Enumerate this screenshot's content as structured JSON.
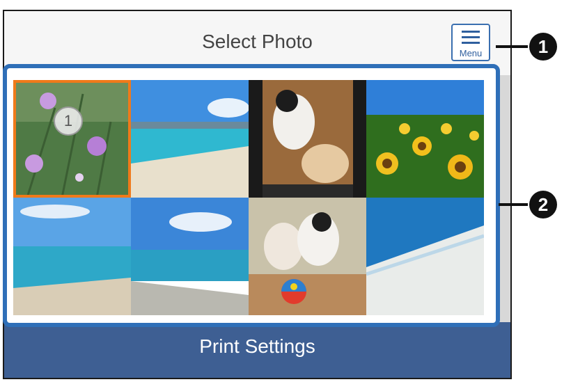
{
  "header": {
    "title": "Select Photo"
  },
  "menu_button": {
    "label": "Menu",
    "icon": "menu-icon"
  },
  "photos": [
    {
      "subject": "flowers",
      "selected": true,
      "selection_number": "1"
    },
    {
      "subject": "beach"
    },
    {
      "subject": "dogs"
    },
    {
      "subject": "sunflowers"
    },
    {
      "subject": "sea"
    },
    {
      "subject": "sea-shore"
    },
    {
      "subject": "dogs-ball"
    },
    {
      "subject": "waves"
    }
  ],
  "footer": {
    "print_settings_label": "Print Settings"
  },
  "callouts": {
    "first": "1",
    "second": "2"
  },
  "colors": {
    "accent_blue": "#2f6fb8",
    "selection_orange": "#f07a1a",
    "footer_blue": "#3e5f93"
  }
}
